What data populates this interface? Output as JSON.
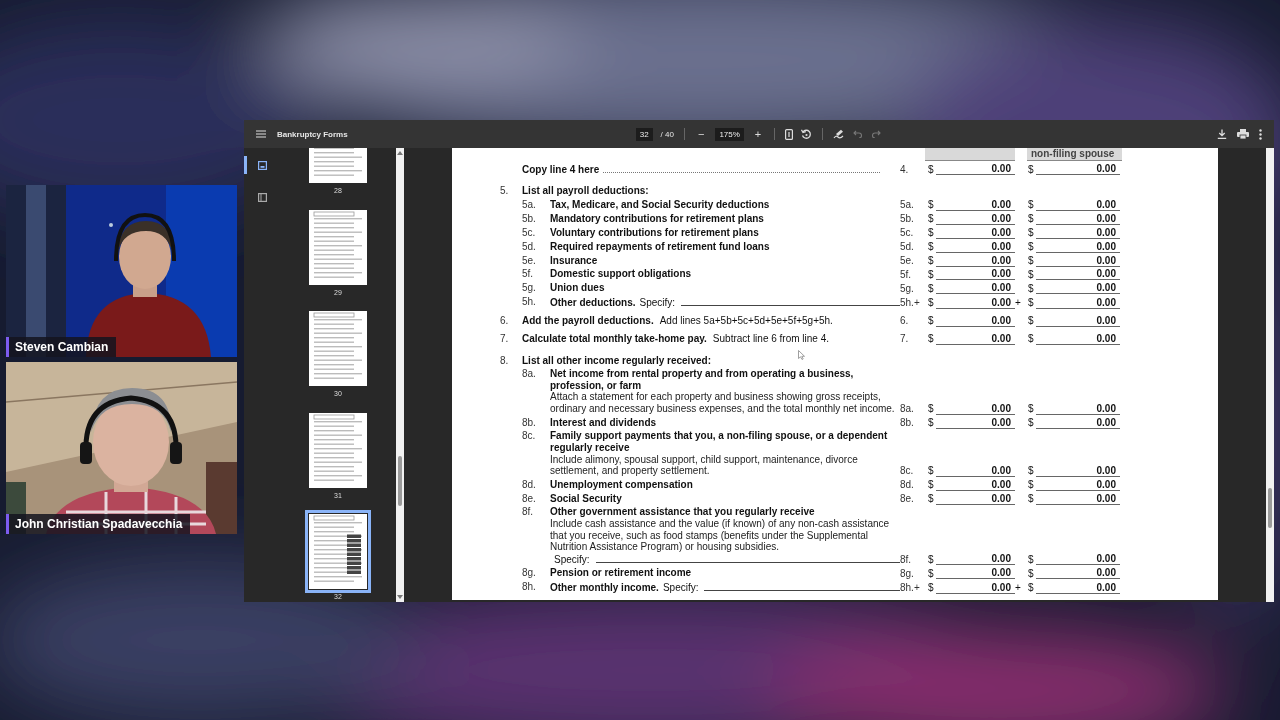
{
  "participants": [
    {
      "name": "Steven Cambian"
    },
    {
      "name": "John Christian Spadavecchia"
    }
  ],
  "viewer": {
    "title": "Bankruptcy Forms",
    "page": "32",
    "page_total": "/ 40",
    "zoom_out": "−",
    "zoom": "175%",
    "zoom_in": "+",
    "undo": {
      "disabled": true
    },
    "redo": {
      "disabled": true
    },
    "sidebar_tabs": [
      {
        "kind": "thumbnails",
        "selected": true
      },
      {
        "kind": "outline",
        "selected": false
      }
    ],
    "thumbnails": [
      {
        "label": "28",
        "selected": false
      },
      {
        "label": "29",
        "selected": false
      },
      {
        "label": "30",
        "selected": false
      },
      {
        "label": "31",
        "selected": false
      },
      {
        "label": "32",
        "selected": true
      }
    ]
  },
  "form": {
    "spouse_column_header": "non-filing spouse",
    "rows": [
      {
        "kind": "copy",
        "label": "Copy line 4 here",
        "ref": "4.",
        "amounts": [
          {
            "sign": "$",
            "value": "0.00"
          },
          {
            "sign": "$",
            "value": "0.00"
          }
        ]
      },
      {
        "kind": "heading",
        "num": "5.",
        "title": "List all payroll deductions:"
      },
      {
        "kind": "item",
        "sub": "5a.",
        "title": "Tax, Medicare, and Social Security deductions",
        "ref": "5a.",
        "amounts": [
          {
            "sign": "$",
            "value": "0.00"
          },
          {
            "sign": "$",
            "value": "0.00"
          }
        ]
      },
      {
        "kind": "item",
        "sub": "5b.",
        "title": "Mandatory contributions for retirement plans",
        "ref": "5b.",
        "amounts": [
          {
            "sign": "$",
            "value": "0.00"
          },
          {
            "sign": "$",
            "value": "0.00"
          }
        ]
      },
      {
        "kind": "item",
        "sub": "5c.",
        "title": "Voluntary contributions for retirement plans",
        "ref": "5c.",
        "amounts": [
          {
            "sign": "$",
            "value": "0.00"
          },
          {
            "sign": "$",
            "value": "0.00"
          }
        ]
      },
      {
        "kind": "item",
        "sub": "5d.",
        "title": "Required repayments of retirement fund loans",
        "ref": "5d.",
        "amounts": [
          {
            "sign": "$",
            "value": "0.00"
          },
          {
            "sign": "$",
            "value": "0.00"
          }
        ]
      },
      {
        "kind": "item",
        "sub": "5e.",
        "title": "Insurance",
        "ref": "5e.",
        "amounts": [
          {
            "sign": "$",
            "value": "0.00"
          },
          {
            "sign": "$",
            "value": "0.00"
          }
        ]
      },
      {
        "kind": "item",
        "sub": "5f.",
        "title": "Domestic support obligations",
        "ref": "5f.",
        "amounts": [
          {
            "sign": "$",
            "value": "0.00"
          },
          {
            "sign": "$",
            "value": "0.00"
          }
        ]
      },
      {
        "kind": "item",
        "sub": "5g.",
        "title": "Union dues",
        "ref": "5g.",
        "amounts": [
          {
            "sign": "$",
            "value": "0.00"
          },
          {
            "sign": "$",
            "value": "0.00"
          }
        ]
      },
      {
        "kind": "item",
        "sub": "5h.",
        "title": "Other deductions.",
        "specify": "Specify:",
        "ref": "5h.+",
        "plus": "+",
        "amounts": [
          {
            "sign": "$",
            "value": "0.00"
          },
          {
            "sign": "$",
            "value": "0.00"
          }
        ]
      },
      {
        "kind": "item",
        "num": "6.",
        "title": "Add the payroll deductions.",
        "note": "Add lines 5a+5b+5c+5d+5e+5f+5g+5h.",
        "ref": "6.",
        "amounts": [
          {
            "sign": "$",
            "value": "0.00"
          },
          {
            "sign": "$",
            "value": "0.00"
          }
        ]
      },
      {
        "kind": "item",
        "num": "7.",
        "title": "Calculate total monthly take-home pay.",
        "note": "Subtract line 6 from line 4.",
        "ref": "7.",
        "amounts": [
          {
            "sign": "$",
            "value": "0.00"
          },
          {
            "sign": "$",
            "value": "0.00"
          }
        ]
      },
      {
        "kind": "heading",
        "num": "8.",
        "title": "List all other income regularly received:"
      },
      {
        "kind": "item",
        "sub": "8a.",
        "title": "Net income from rental property and from operating a business, profession, or farm",
        "description": "Attach a statement for each property and business showing gross receipts, ordinary and necessary business expenses, and the total monthly net income.",
        "ref": "8a.",
        "amounts": [
          {
            "sign": "$",
            "value": "0.00"
          },
          {
            "sign": "$",
            "value": "0.00"
          }
        ]
      },
      {
        "kind": "item",
        "sub": "8b.",
        "title": "Interest and dividends",
        "ref": "8b.",
        "amounts": [
          {
            "sign": "$",
            "value": "0.00"
          },
          {
            "sign": "$",
            "value": "0.00"
          }
        ]
      },
      {
        "kind": "item",
        "sub": "8c.",
        "title": "Family support payments that you, a non-filing spouse, or a dependent regularly receive",
        "description": "Include alimony, spousal support, child support, maintenance, divorce settlement, and property settlement.",
        "ref": "8c.",
        "amounts": [
          {
            "sign": "$",
            "value": "0.00"
          },
          {
            "sign": "$",
            "value": "0.00"
          }
        ]
      },
      {
        "kind": "item",
        "sub": "8d.",
        "title": "Unemployment compensation",
        "ref": "8d.",
        "amounts": [
          {
            "sign": "$",
            "value": "0.00"
          },
          {
            "sign": "$",
            "value": "0.00"
          }
        ]
      },
      {
        "kind": "item",
        "sub": "8e.",
        "title": "Social Security",
        "ref": "8e.",
        "amounts": [
          {
            "sign": "$",
            "value": "0.00"
          },
          {
            "sign": "$",
            "value": "0.00"
          }
        ]
      },
      {
        "kind": "item",
        "sub": "8f.",
        "title": "Other government assistance that you regularly receive",
        "description": "Include cash assistance and the value (if known) of any non-cash assistance that you receive, such as food stamps (benefits under the Supplemental Nutrition Assistance Program) or housing subsidies.",
        "specify": "Specify:",
        "ref": "8f.",
        "amounts": [
          {
            "sign": "$",
            "value": "0.00"
          },
          {
            "sign": "$",
            "value": "0.00"
          }
        ]
      },
      {
        "kind": "item",
        "sub": "8g.",
        "title": "Pension or retirement income",
        "ref": "8g.",
        "amounts": [
          {
            "sign": "$",
            "value": "0.00"
          },
          {
            "sign": "$",
            "value": "0.00"
          }
        ]
      },
      {
        "kind": "item",
        "sub": "8h.",
        "title": "Other monthly income.",
        "specify": "Specify:",
        "ref": "8h.+",
        "plus": "+",
        "amounts": [
          {
            "sign": "$",
            "value": "0.00"
          },
          {
            "sign": "$",
            "value": "0.00"
          }
        ]
      }
    ]
  }
}
